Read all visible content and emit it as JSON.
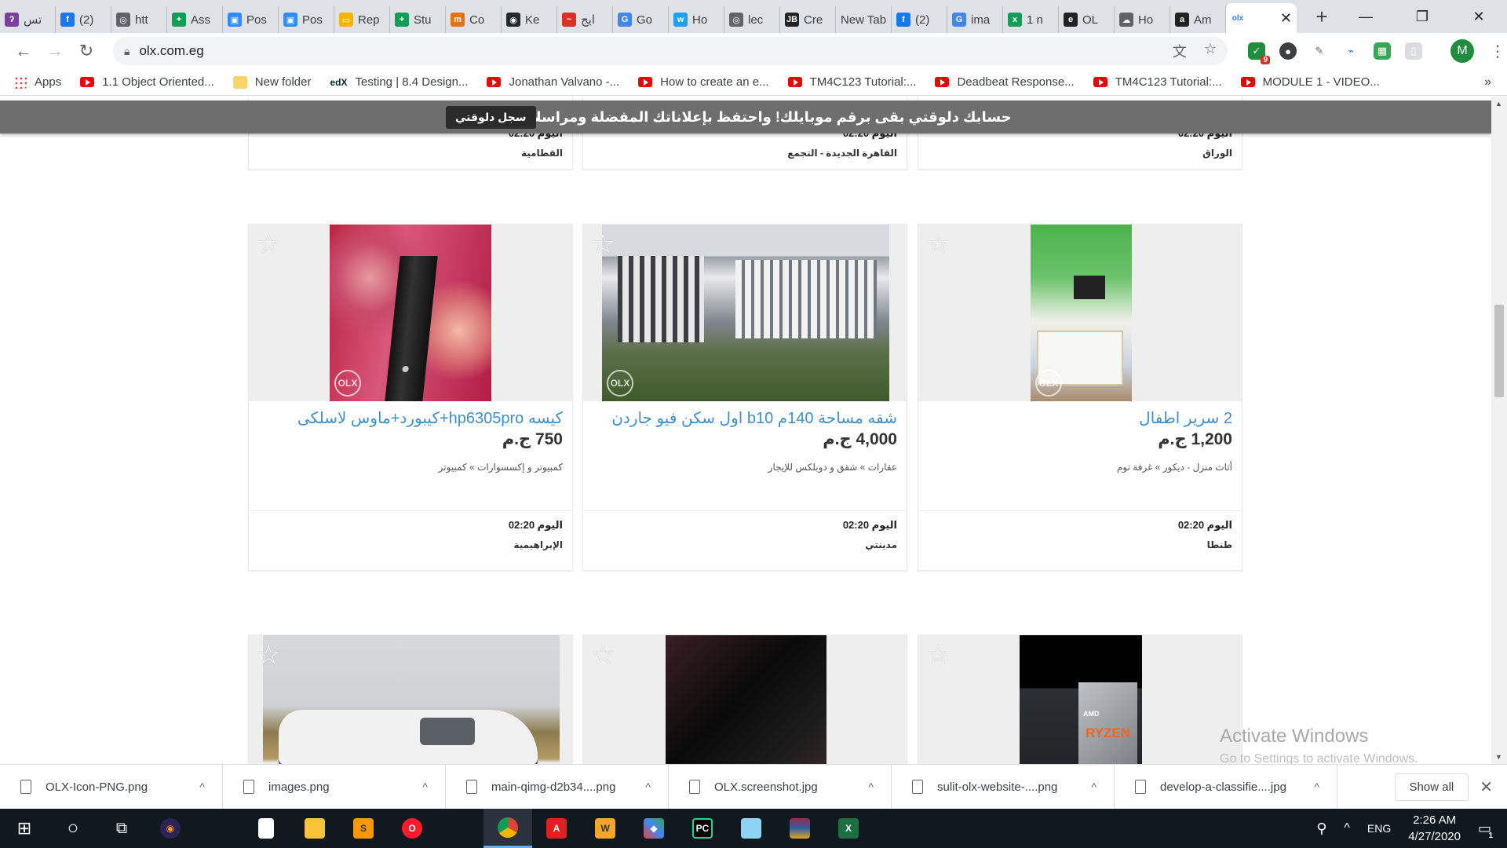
{
  "tabs": [
    {
      "label": "تس",
      "color": "#7b3fa0",
      "glyph": "ʔ"
    },
    {
      "label": "(2)",
      "color": "#1877f2",
      "glyph": "f"
    },
    {
      "label": "htt",
      "color": "#5f6368",
      "glyph": "◎"
    },
    {
      "label": "Ass",
      "color": "#0f9d58",
      "glyph": "+"
    },
    {
      "label": "Pos",
      "color": "#2d8cff",
      "glyph": "▣"
    },
    {
      "label": "Pos",
      "color": "#2d8cff",
      "glyph": "▣"
    },
    {
      "label": "Rep",
      "color": "#f4b400",
      "glyph": "▭"
    },
    {
      "label": "Stu",
      "color": "#0f9d58",
      "glyph": "+"
    },
    {
      "label": "Co",
      "color": "#e8710a",
      "glyph": "m"
    },
    {
      "label": "Ke",
      "color": "#24292e",
      "glyph": "◉"
    },
    {
      "label": "ايج",
      "color": "#d93025",
      "glyph": "~"
    },
    {
      "label": "Go",
      "color": "#4285f4",
      "glyph": "G"
    },
    {
      "label": "Ho",
      "color": "#1da1f2",
      "glyph": "w"
    },
    {
      "label": "lec",
      "color": "#5f6368",
      "glyph": "◎"
    },
    {
      "label": "Cre",
      "color": "#222",
      "glyph": "JB"
    },
    {
      "label": "New Tab",
      "color": "",
      "glyph": ""
    },
    {
      "label": "(2)",
      "color": "#1877f2",
      "glyph": "f"
    },
    {
      "label": "ima",
      "color": "#4285f4",
      "glyph": "G"
    },
    {
      "label": "1 n",
      "color": "#0f9d58",
      "glyph": "x"
    },
    {
      "label": "OL",
      "color": "#222",
      "glyph": "e"
    },
    {
      "label": "Ho",
      "color": "#5f6368",
      "glyph": "☁"
    },
    {
      "label": "Am",
      "color": "#222",
      "glyph": "a"
    }
  ],
  "active_tab": {
    "label": "olx",
    "close": "✕"
  },
  "new_tab_glyph": "+",
  "window_controls": {
    "minimize": "—",
    "maximize": "❐",
    "close": "✕"
  },
  "address": {
    "url": "olx.com.eg"
  },
  "profile_initial": "M",
  "extension_badge": "9",
  "bookmarks": [
    {
      "label": "Apps",
      "icon": "apps"
    },
    {
      "label": "1.1 Object Oriented...",
      "icon": "youtube"
    },
    {
      "label": "New folder",
      "icon": "folder"
    },
    {
      "label": "Testing | 8.4 Design...",
      "icon": "edx"
    },
    {
      "label": "Jonathan Valvano -...",
      "icon": "youtube"
    },
    {
      "label": "How to create an e...",
      "icon": "youtube"
    },
    {
      "label": "TM4C123 Tutorial:...",
      "icon": "youtube"
    },
    {
      "label": "Deadbeat Response...",
      "icon": "youtube"
    },
    {
      "label": "TM4C123 Tutorial:...",
      "icon": "youtube"
    },
    {
      "label": "MODULE 1 - VIDEO...",
      "icon": "youtube"
    }
  ],
  "bookmarks_more": "»",
  "banner": {
    "text": "حسابك دلوقتي بقى برقم موبايلك! واحتفظ بإعلاناتك المفضلة ومراسلاتك كلها",
    "button": "سجل دلوقتي"
  },
  "top_row": [
    {
      "time": "اليوم 02:20",
      "location": "القطامية"
    },
    {
      "time": "اليوم 02:20",
      "location": "القاهرة الجديدة - التجمع"
    },
    {
      "time": "اليوم 02:20",
      "location": "الوراق"
    }
  ],
  "listings": [
    {
      "title": "كيسه hp6305pro+كيبورد+ماوس لاسلكى",
      "price": "750 ج.م",
      "category": "كمبيوتر و إكسسوارات » كمبيوتر",
      "time": "اليوم 02:20",
      "location": "الإبراهيمية",
      "watermark": "OLX"
    },
    {
      "title": "شقه مساحة 140م b10 اول سكن فيو جاردن",
      "price": "4,000 ج.م",
      "category": "عقارات » شقق و دوبلكس للإيجار",
      "time": "اليوم 02:20",
      "location": "مدينتي",
      "watermark": "OLX"
    },
    {
      "title": "2 سرير اطفال",
      "price": "1,200 ج.م",
      "category": "أثاث منزل - ديكور » غرفة نوم",
      "time": "اليوم 02:20",
      "location": "طنطا",
      "watermark": "OLX"
    }
  ],
  "bottom_row": [
    {
      "image": "car"
    },
    {
      "image": "dark-box"
    },
    {
      "image": "ryzen",
      "brand": "RYZEN",
      "maker": "AMD"
    }
  ],
  "watermark": {
    "title": "Activate Windows",
    "subtitle": "Go to Settings to activate Windows."
  },
  "downloads": [
    {
      "name": "OLX-Icon-PNG.png"
    },
    {
      "name": "images.png"
    },
    {
      "name": "main-qimg-d2b34....png"
    },
    {
      "name": "OLX.screenshot.jpg"
    },
    {
      "name": "sulit-olx-website-....png"
    },
    {
      "name": "develop-a-classifie....jpg"
    }
  ],
  "downloads_show_all": "Show all",
  "downloads_close": "✕",
  "taskbar": {
    "lang": "ENG",
    "time": "2:26 AM",
    "date": "4/27/2020",
    "notif": "1"
  }
}
